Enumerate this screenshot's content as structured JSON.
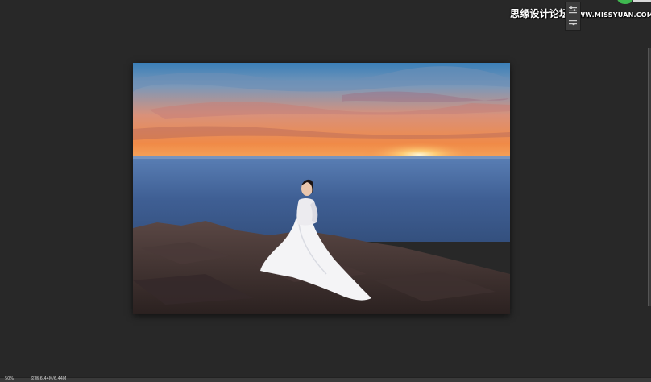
{
  "overlay": {
    "watermark_text": "思缘设计论坛",
    "watermark_url": "WWW.MISSYUAN.COM"
  },
  "canvas": {
    "image_description": "Bride in white wedding dress sitting on dark seaside rocks at sunset over the ocean"
  },
  "colors": {
    "workspace_bg": "#282828",
    "sky_top": "#3d7db3",
    "sunset": "#f0894a",
    "sea": "#3f5f94",
    "rocks": "#3b2e2c",
    "dress": "#f4f4f6",
    "status_orb": "#3fb950"
  },
  "status_bar": {
    "zoom": "50%",
    "doc_info": "文档:6.44M/6.44M"
  },
  "icons": {
    "tool_1": "brush-settings-icon",
    "tool_2": "adjust-icon"
  }
}
